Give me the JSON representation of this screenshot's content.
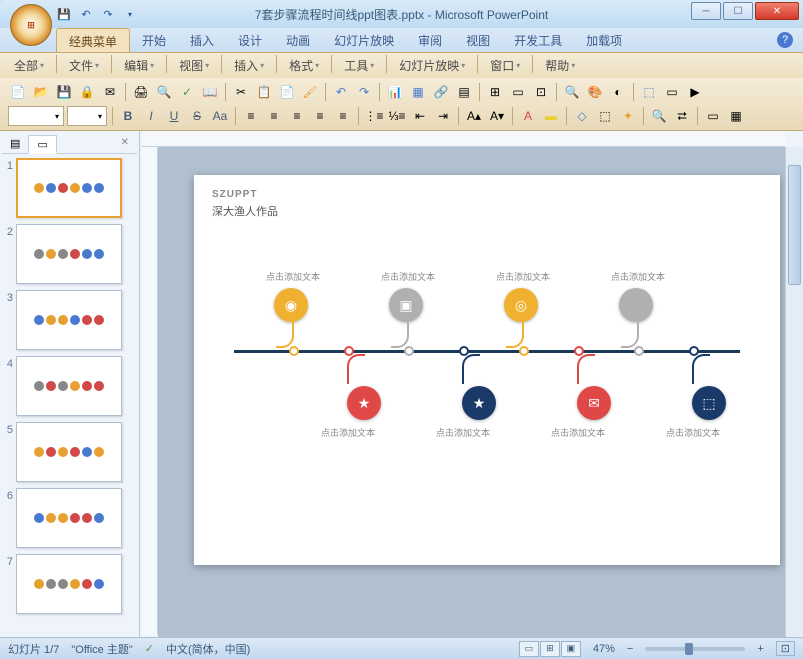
{
  "title": "7套步骤流程时间线ppt图表.pptx - Microsoft PowerPoint",
  "ribbon_tabs": [
    "经典菜单",
    "开始",
    "插入",
    "设计",
    "动画",
    "幻灯片放映",
    "审阅",
    "视图",
    "开发工具",
    "加载项"
  ],
  "active_tab": 0,
  "menus": [
    "全部",
    "文件",
    "编辑",
    "视图",
    "插入",
    "格式",
    "工具",
    "幻灯片放映",
    "窗口",
    "帮助"
  ],
  "slides_tabs": {
    "outline": "",
    "slides": ""
  },
  "slide": {
    "title1": "SZUPPT",
    "title2": "深大渔人作品",
    "placeholder": "点击添加文本"
  },
  "slide_count": 7,
  "current_slide": 1,
  "status": {
    "slide_info": "幻灯片 1/7",
    "theme": "\"Office 主题\"",
    "lang": "中文(简体，中国)",
    "zoom": "47%"
  },
  "timeline_items": [
    {
      "pos": 60,
      "side": "up",
      "color": "#f0b030",
      "icon": "◉"
    },
    {
      "pos": 175,
      "side": "up",
      "color": "#b0b0b0",
      "icon": "▣"
    },
    {
      "pos": 290,
      "side": "up",
      "color": "#f0b030",
      "icon": "◎"
    },
    {
      "pos": 405,
      "side": "up",
      "color": "#b0b0b0",
      "icon": ""
    },
    {
      "pos": 115,
      "side": "down",
      "color": "#e04848",
      "icon": "★"
    },
    {
      "pos": 230,
      "side": "down",
      "color": "#1a3a6a",
      "icon": "★"
    },
    {
      "pos": 345,
      "side": "down",
      "color": "#e04848",
      "icon": "✉"
    },
    {
      "pos": 460,
      "side": "down",
      "color": "#1a3a6a",
      "icon": "⬚"
    }
  ]
}
